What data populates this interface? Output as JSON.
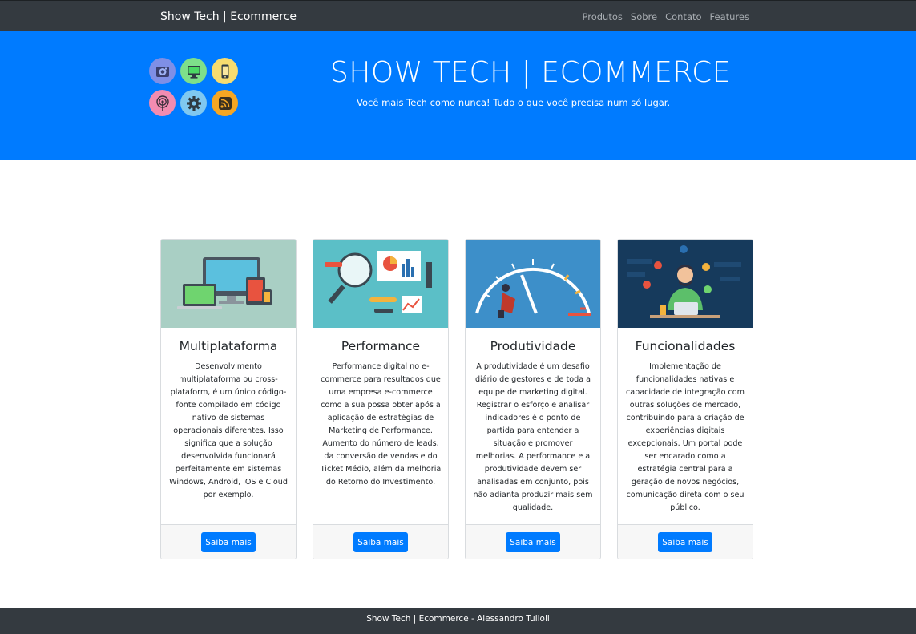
{
  "navbar": {
    "brand": "Show Tech | Ecommerce",
    "links": [
      "Produtos",
      "Sobre",
      "Contato",
      "Features"
    ]
  },
  "hero": {
    "title": "SHOW TECH | ECOMMERCE",
    "subtitle": "Você mais Tech como nunca! Tudo o que você precisa num só lugar.",
    "icons": [
      "camera-icon",
      "monitor-icon",
      "phone-icon",
      "podcast-icon",
      "gear-icon",
      "rss-icon"
    ]
  },
  "cards": [
    {
      "title": "Multiplataforma",
      "text": "Desenvolvimento multiplataforma ou cross-plataform, é um único código-fonte compilado em código nativo de sistemas operacionais diferentes. Isso significa que a solução desenvolvida funcionará perfeitamente em sistemas Windows, Android, iOS e Cloud por exemplo.",
      "button": "Saiba mais"
    },
    {
      "title": "Performance",
      "text": "Performance digital no e-commerce para resultados que uma empresa e-commerce como a sua possa obter após a aplicação de estratégias de Marketing de Performance. Aumento do número de leads, da conversão de vendas e do Ticket Médio, além da melhoria do Retorno do Investimento.",
      "button": "Saiba mais"
    },
    {
      "title": "Produtividade",
      "text": "A produtividade é um desafio diário de gestores e de toda a equipe de marketing digital. Registrar o esforço e analisar indicadores é o ponto de partida para entender a situação e promover melhorias. A performance e a produtividade devem ser analisadas em conjunto, pois não adianta produzir mais sem qualidade.",
      "button": "Saiba mais"
    },
    {
      "title": "Funcionalidades",
      "text": "Implementação de funcionalidades nativas e capacidade de integração com outras soluções de mercado, contribuindo para a criação de experiências digitais excepcionais. Um portal pode ser encarado como a estratégia central para a geração de novos negócios, comunicação direta com o seu público.",
      "button": "Saiba mais"
    }
  ],
  "footer": {
    "text": "Show Tech | Ecommerce - Alessandro Tulioli"
  },
  "colors": {
    "navbar": "#343a40",
    "hero": "#007bff",
    "button": "#007bff",
    "card_footer": "#f7f7f7"
  }
}
